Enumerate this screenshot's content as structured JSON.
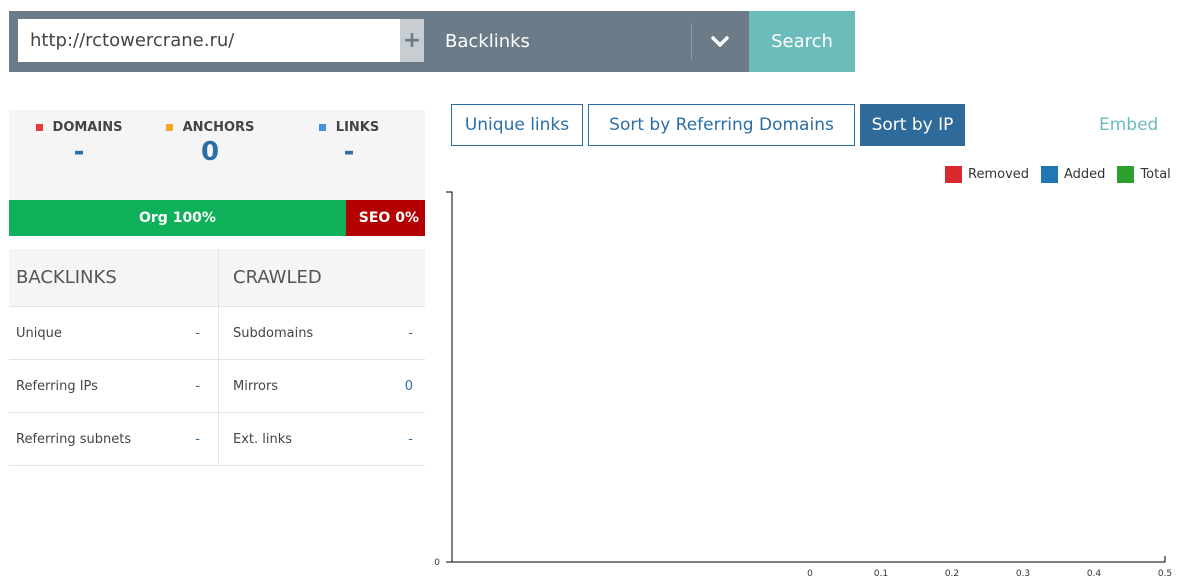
{
  "search": {
    "url_value": "http://rctowercrane.ru/",
    "plus_label": "+",
    "mode_label": "Backlinks",
    "search_label": "Search"
  },
  "stats": {
    "domains": {
      "label": "DOMAINS",
      "value": "-",
      "color": "#e53b3b"
    },
    "anchors": {
      "label": "ANCHORS",
      "value": "0",
      "color": "#f5a623"
    },
    "links": {
      "label": "LINKS",
      "value": "-",
      "color": "#4a90e2"
    }
  },
  "ratio": {
    "org_label": "Org 100%",
    "org_fraction": 0.81,
    "seo_label": "SEO 0%",
    "org_color": "#0fb05a",
    "seo_color": "#b30000"
  },
  "table": {
    "headers": [
      "BACKLINKS",
      "CRAWLED"
    ],
    "rows": [
      {
        "left_label": "Unique",
        "left_value": "-",
        "right_label": "Subdomains",
        "right_value": "-"
      },
      {
        "left_label": "Referring IPs",
        "left_value": "-",
        "right_label": "Mirrors",
        "right_value": "0"
      },
      {
        "left_label": "Referring subnets",
        "left_value": "-",
        "right_label": "Ext. links",
        "right_value": "-"
      }
    ]
  },
  "controls": {
    "unique_links": "Unique links",
    "sort_domains": "Sort by Referring Domains",
    "sort_ip": "Sort by IP",
    "embed": "Embed"
  },
  "chart_data": {
    "type": "bar",
    "series": [
      {
        "name": "Removed",
        "color": "#d9292f",
        "values": []
      },
      {
        "name": "Added",
        "color": "#1f77b4",
        "values": []
      },
      {
        "name": "Total",
        "color": "#2ca02c",
        "values": []
      }
    ],
    "y_ticks": [
      "0"
    ],
    "x_ticks": [
      "0",
      "0.1",
      "0.2",
      "0.3",
      "0.4",
      "0.5"
    ],
    "xlim": [
      0,
      0.5
    ],
    "grid": false,
    "legend_position": "top-right"
  }
}
